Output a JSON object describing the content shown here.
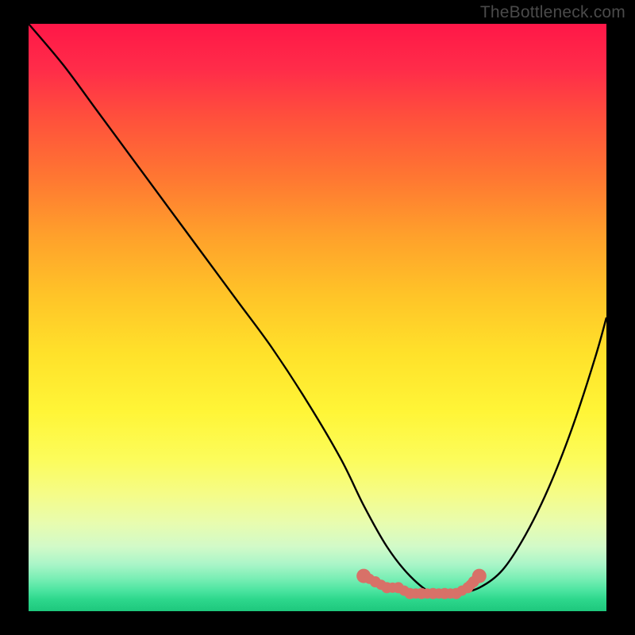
{
  "watermark": "TheBottleneck.com",
  "chart_data": {
    "type": "line",
    "title": "",
    "xlabel": "",
    "ylabel": "",
    "xlim": [
      0,
      100
    ],
    "ylim": [
      0,
      100
    ],
    "grid": false,
    "legend": false,
    "series": [
      {
        "name": "curve",
        "color": "#000000",
        "x": [
          0,
          6,
          12,
          18,
          24,
          30,
          36,
          42,
          48,
          54,
          58,
          62,
          66,
          70,
          74,
          78,
          82,
          86,
          90,
          94,
          98,
          100
        ],
        "values": [
          100,
          93,
          85,
          77,
          69,
          61,
          53,
          45,
          36,
          26,
          18,
          11,
          6,
          3,
          3,
          4,
          7,
          13,
          21,
          31,
          43,
          50
        ]
      },
      {
        "name": "dotted-region",
        "color": "#d87168",
        "style": "dotted-thick",
        "x": [
          58,
          60,
          62,
          64,
          66,
          68,
          70,
          72,
          74,
          76,
          77,
          78
        ],
        "values": [
          6,
          5,
          4,
          4,
          3,
          3,
          3,
          3,
          3,
          4,
          5,
          6
        ]
      }
    ],
    "gradient_stops": [
      {
        "pos": 0.0,
        "color": "#ff1748"
      },
      {
        "pos": 0.26,
        "color": "#ff7632"
      },
      {
        "pos": 0.56,
        "color": "#ffe12a"
      },
      {
        "pos": 0.8,
        "color": "#f5fc87"
      },
      {
        "pos": 0.92,
        "color": "#aaf5c8"
      },
      {
        "pos": 1.0,
        "color": "#1ec87d"
      }
    ]
  }
}
